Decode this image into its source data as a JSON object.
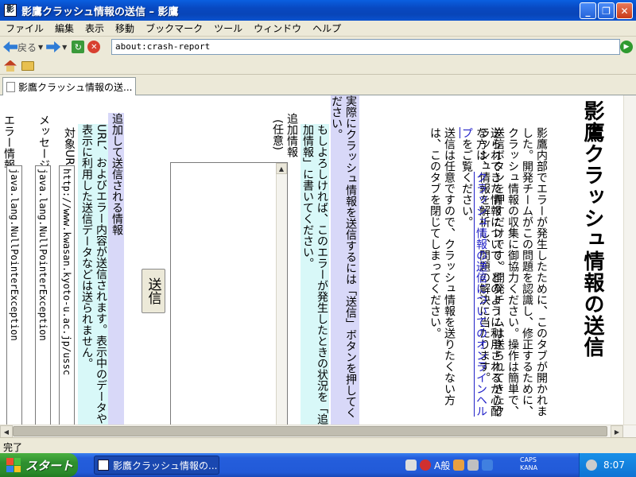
{
  "window": {
    "title": "影鷹クラッシュ情報の送信 – 影鷹"
  },
  "menu": [
    "ファイル",
    "編集",
    "表示",
    "移動",
    "ブックマーク",
    "ツール",
    "ウィンドウ",
    "ヘルプ"
  ],
  "nav": {
    "back_label": "戻る",
    "url": "about:crash-report"
  },
  "tab": {
    "label": "影鷹クラッシュ情報の送..."
  },
  "page": {
    "heading": "影鷹クラッシュ情報の送信",
    "intro": "影鷹内部でエラーが発生したために、このタブが開かれました。開発チームがこの問題を認識し、修正するために、クラッシュ情報の収集に御協力ください。操作は簡単で、送信ボタンを押すだけです。開発チームは送られてきたクラッシュ情報を解析し、問題の解決に当たります。",
    "para2_before": "送られてきた情報について、どのように利用されるか心配な方は、",
    "para2_link": "クラッシュ情報の送信についてのオンラインヘルプ",
    "para2_after": "をご覧ください。",
    "para3": "送信は任意ですので、クラッシュ情報を送りたくない方は、このタブを閉じてしまってください。",
    "instruction": "実際にクラッシュ情報を送信するには「送信」ボタンを押してください。",
    "optional_note": "もしよろしければ、このエラーが発生したときの状況を「追加情報」に書いてください。",
    "additional_label": "追加情報",
    "optional_label": "(任意)",
    "submit_label": "送信",
    "extra_heading": "追加して送信される情報",
    "extra_desc": "URL、およびエラー内容が送信されます。表示中のデータや表示に利用した送信データなどは送られません。",
    "url_label": "対象URL",
    "url_value": "http://www.kwasan.kyoto-u.ac.jp/ussc",
    "message_label": "メッセージ",
    "message_value": "java.lang.NullPointerException",
    "error_label": "エラー情報",
    "error_value": "java.lang.NullPointerException"
  },
  "status": {
    "text": "完了"
  },
  "taskbar": {
    "start_label": "スタート",
    "window_label": "影鷹クラッシュ情報の...",
    "ime_label": "A般",
    "caps": "CAPS",
    "kana": "KANA",
    "clock": "8:07"
  }
}
